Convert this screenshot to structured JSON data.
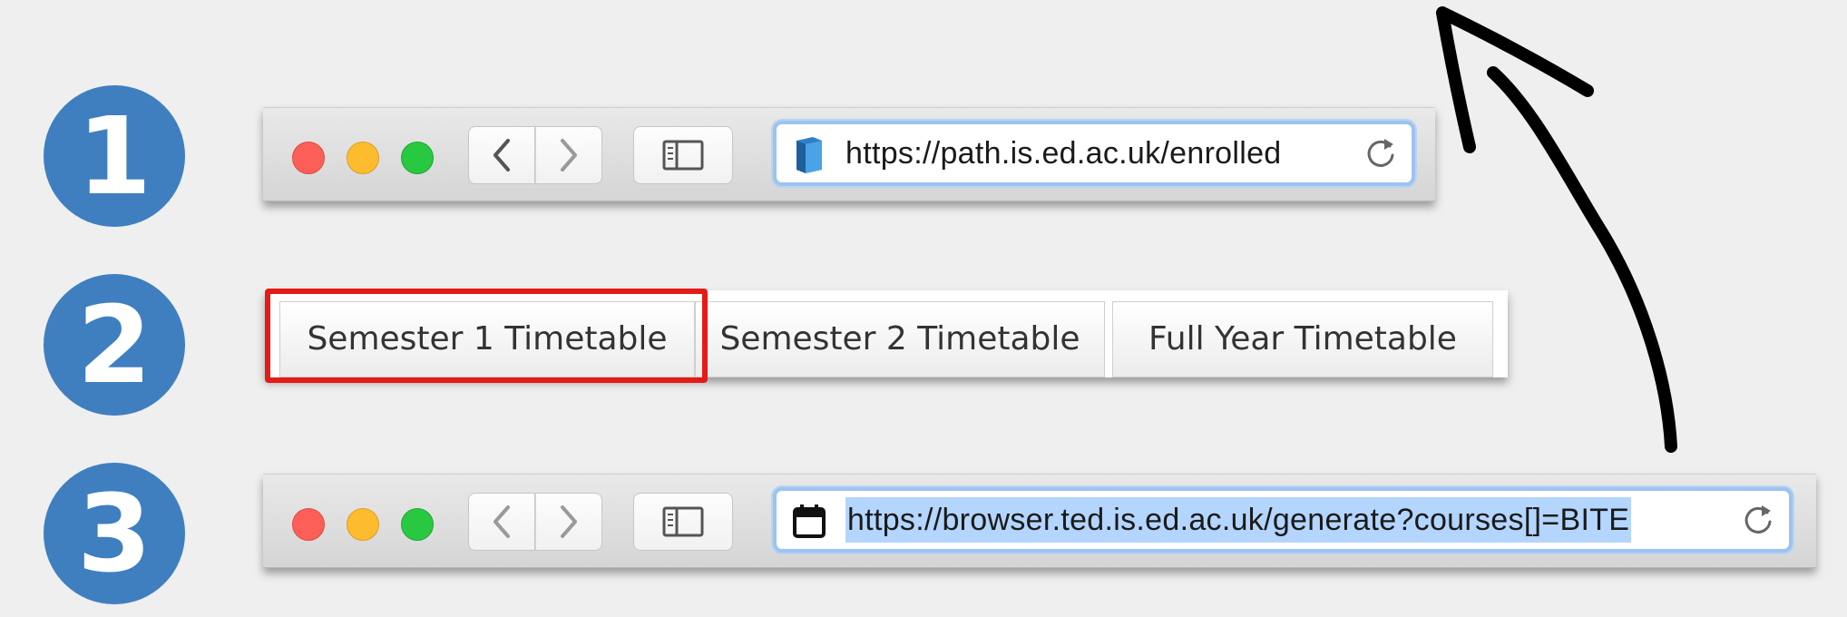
{
  "steps": {
    "one": "1",
    "two": "2",
    "three": "3"
  },
  "toolbar1": {
    "url": "https://path.is.ed.ac.uk/enrolled",
    "site_icon": "book-icon",
    "icon_color": "#3b8fd4"
  },
  "tabs": [
    {
      "label": "Semester 1 Timetable",
      "highlighted": true
    },
    {
      "label": "Semester 2 Timetable"
    },
    {
      "label": "Full Year Timetable"
    }
  ],
  "toolbar3": {
    "url": "https://browser.ted.is.ed.ac.uk/generate?courses[]=BITE",
    "site_icon": "calendar-icon",
    "selected": true
  },
  "colors": {
    "step_circle": "#3f7fc0",
    "highlight_border": "#e41b17",
    "address_focus": "#9ec3ee",
    "selection": "#b3d5fe"
  }
}
